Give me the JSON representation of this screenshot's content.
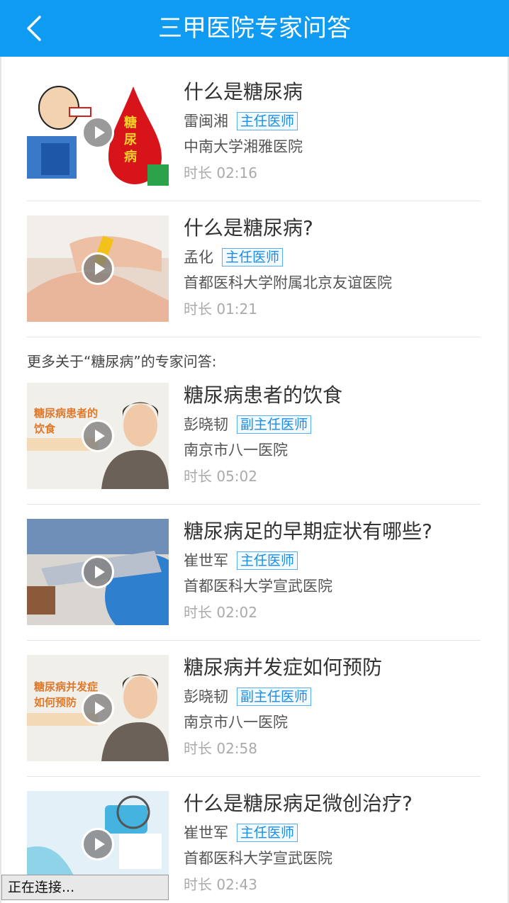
{
  "header": {
    "title": "三甲医院专家问答"
  },
  "more_label": "更多关于“糖尿病”的专家问答:",
  "items": [
    {
      "title": "什么是糖尿病",
      "doctor": "雷闽湘",
      "rank": "主任医师",
      "hospital": "中南大学湘雅医院",
      "duration": "时长 02:16"
    },
    {
      "title": "什么是糖尿病?",
      "doctor": "孟化",
      "rank": "主任医师",
      "hospital": "首都医科大学附属北京友谊医院",
      "duration": "时长 01:21"
    },
    {
      "title": "糖尿病患者的饮食",
      "doctor": "彭晓韧",
      "rank": "副主任医师",
      "hospital": "南京市八一医院",
      "duration": "时长 05:02",
      "thumb_text": [
        "糖尿病患者的",
        "饮食"
      ]
    },
    {
      "title": "糖尿病足的早期症状有哪些?",
      "doctor": "崔世军",
      "rank": "主任医师",
      "hospital": "首都医科大学宣武医院",
      "duration": "时长 02:02"
    },
    {
      "title": "糖尿病并发症如何预防",
      "doctor": "彭晓韧",
      "rank": "副主任医师",
      "hospital": "南京市八一医院",
      "duration": "时长 02:58",
      "thumb_text": [
        "糖尿病并发症",
        "如何预防"
      ]
    },
    {
      "title": "什么是糖尿病足微创治疗?",
      "doctor": "崔世军",
      "rank": "主任医师",
      "hospital": "首都医科大学宣武医院",
      "duration": "时长 02:43"
    }
  ],
  "thumb1_text": "糖尿病",
  "status": "正在连接..."
}
